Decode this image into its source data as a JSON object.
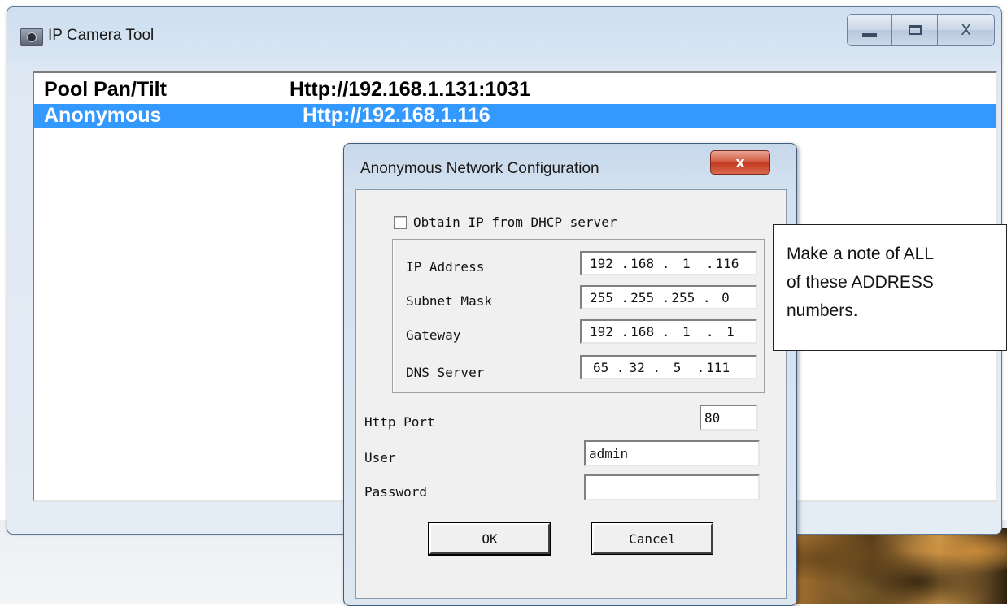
{
  "window": {
    "title": "IP Camera Tool",
    "controls": {
      "minimize": "minimize",
      "maximize": "maximize",
      "close": "X"
    }
  },
  "camera_list": [
    {
      "name": "Pool Pan/Tilt",
      "url": "Http://192.168.1.131:1031",
      "selected": false
    },
    {
      "name": "Anonymous",
      "url": "Http://192.168.1.116",
      "selected": true
    }
  ],
  "dialog": {
    "title": "Anonymous Network Configuration",
    "close_label": "x",
    "dhcp_label": "Obtain IP from DHCP server",
    "dhcp_checked": false,
    "fields": [
      {
        "label": "IP Address",
        "octets": [
          "192",
          "168",
          "1",
          "116"
        ]
      },
      {
        "label": "Subnet Mask",
        "octets": [
          "255",
          "255",
          "255",
          "0"
        ]
      },
      {
        "label": "Gateway",
        "octets": [
          "192",
          "168",
          "1",
          "1"
        ]
      },
      {
        "label": "DNS Server",
        "octets": [
          "65",
          "32",
          "5",
          "111"
        ]
      }
    ],
    "http_port_label": "Http Port",
    "http_port_value": "80",
    "user_label": "User",
    "user_value": "admin",
    "password_label": "Password",
    "password_value": "",
    "ok_label": "OK",
    "cancel_label": "Cancel"
  },
  "note": {
    "line1": "Make a note of ALL",
    "line2": "of these ADDRESS",
    "line3": "numbers."
  }
}
